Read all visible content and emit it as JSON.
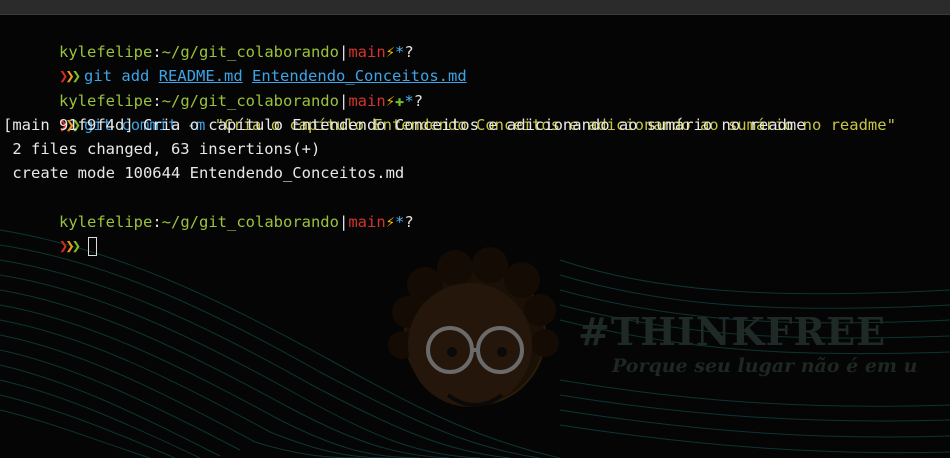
{
  "prompt": {
    "user": "kylefelipe",
    "colon": ":",
    "path": "~/g/git_colaborando",
    "separator": "|",
    "branch": "main",
    "bolt": "⚡",
    "dirty": "*",
    "staged": "✚",
    "question": "?",
    "arrows": [
      "❯",
      "❯",
      "❯"
    ]
  },
  "commands": {
    "cmd1_base": "git add",
    "cmd1_file1": "README.md",
    "cmd1_file2": "Entendendo_Conceitos.md",
    "cmd2_base": "git commit -m",
    "cmd2_message": "\"Cria o capítulo Entendendo Conceitos e adicionando ao sumário no readme\""
  },
  "output": {
    "line1": "[main 91f9f4d] Cria o capítulo Entendendo Conceitos e adicionando ao sumário no readme",
    "line2": " 2 files changed, 63 insertions(+)",
    "line3": " create mode 100644 Entendendo_Conceitos.md"
  },
  "wallpaper": {
    "brand": "#THINKFREE",
    "tagline": "Porque seu lugar não é em u"
  },
  "colors": {
    "background": "#050505",
    "prompt_green": "#9ac33c",
    "branch_red": "#d2352b",
    "command_blue": "#3fa4e6",
    "string_yellow": "#c7c545"
  }
}
